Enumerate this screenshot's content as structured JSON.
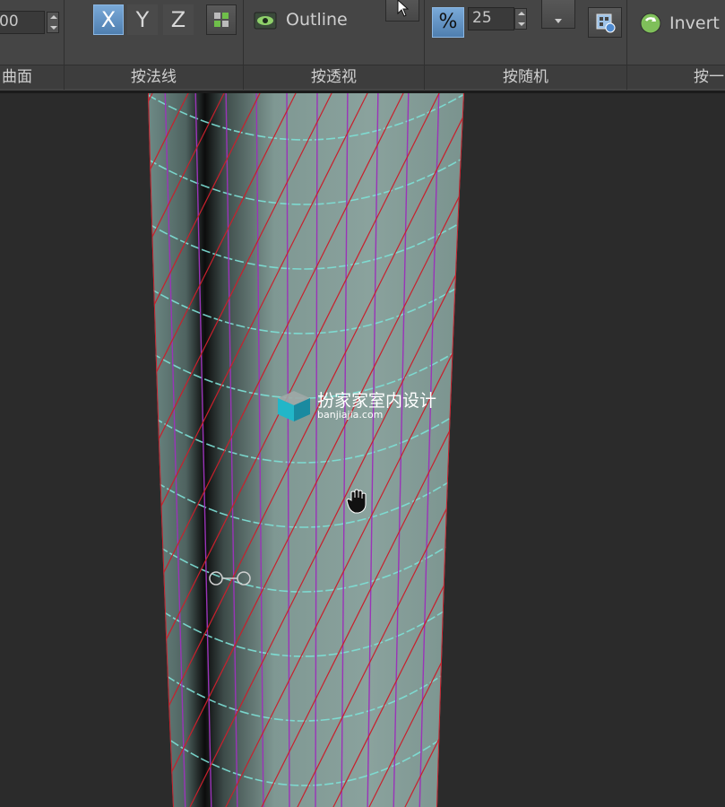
{
  "ribbon": {
    "groups": [
      {
        "title": "曲面",
        "spinner_value": "00"
      },
      {
        "title": "按法线",
        "axes": [
          "X",
          "Y",
          "Z"
        ]
      },
      {
        "title": "按透视",
        "outline_label": "Outline"
      },
      {
        "title": "按随机",
        "percent_label": "%",
        "spinner_value": "25"
      },
      {
        "title": "按一",
        "invert_label": "Invert ."
      }
    ]
  },
  "watermark": {
    "brand": "扮家家室内设计",
    "url": "banjiajia.com"
  },
  "colors": {
    "mesh_surface": "#7f9893",
    "wire_red": "#c8202c",
    "wire_purple": "#9a34b8",
    "edge_ring": "#7de0d6",
    "accent_blue": "#5b8fc4"
  }
}
